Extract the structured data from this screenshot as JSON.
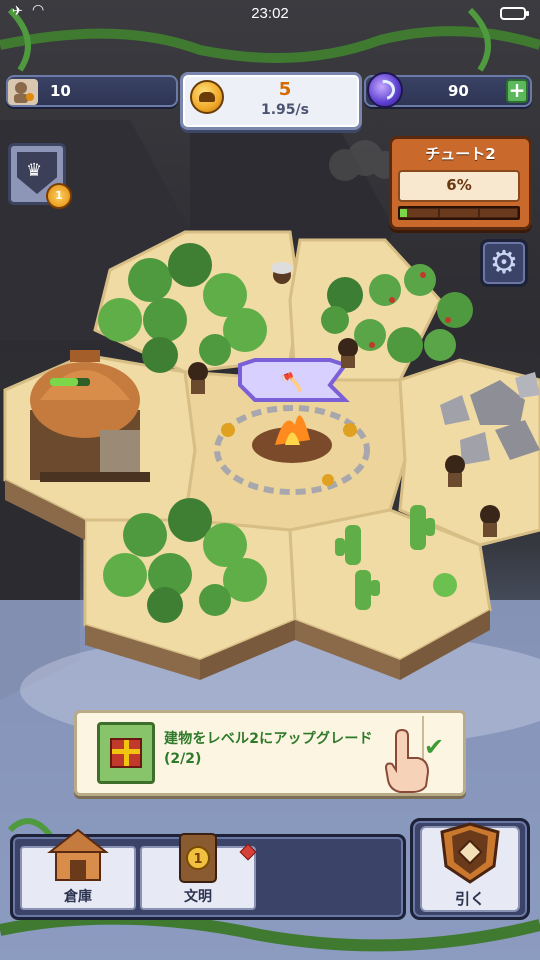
{
  "status_bar": {
    "time": "23:02"
  },
  "resources": {
    "population": "10",
    "coins": "5",
    "coin_rate": "1.95/s",
    "gems": "90",
    "add_symbol": "+"
  },
  "rank": {
    "level": "1"
  },
  "chapter": {
    "title": "チュート2",
    "progress_text": "6%",
    "progress": 0.06
  },
  "quest": {
    "text": "建物をレベル2にアップグレード",
    "progress": "(2/2)",
    "completed": true
  },
  "bottom_nav": {
    "warehouse_label": "倉庫",
    "civilization_label": "文明",
    "civilization_level": "1",
    "draw_label": "引く"
  },
  "colors": {
    "coin_text": "#d46a00",
    "quest_text": "#2e7a2a",
    "chapter_panel": "#c96a2c",
    "progress_fill": "#7cd64a"
  },
  "icons": [
    "airplane-icon",
    "wifi-icon",
    "battery-icon",
    "population-icon",
    "coin-icon",
    "gem-icon",
    "plus-icon",
    "crown-icon",
    "gear-icon",
    "gift-icon",
    "check-icon",
    "hand-pointer-icon",
    "warehouse-icon",
    "civilization-icon",
    "alert-icon",
    "card-deck-icon",
    "axe-icon"
  ]
}
